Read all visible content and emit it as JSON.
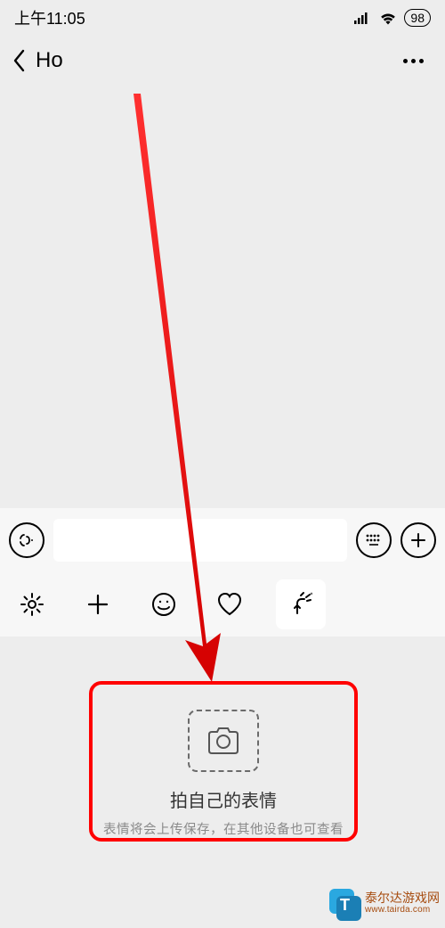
{
  "status": {
    "time": "上午11:05",
    "battery": "98"
  },
  "nav": {
    "title": "Ho"
  },
  "panel": {
    "title": "拍自己的表情",
    "subtitle": "表情将会上传保存，在其他设备也可查看"
  },
  "watermark": {
    "name": "泰尔达游戏网",
    "url": "www.tairda.com"
  }
}
